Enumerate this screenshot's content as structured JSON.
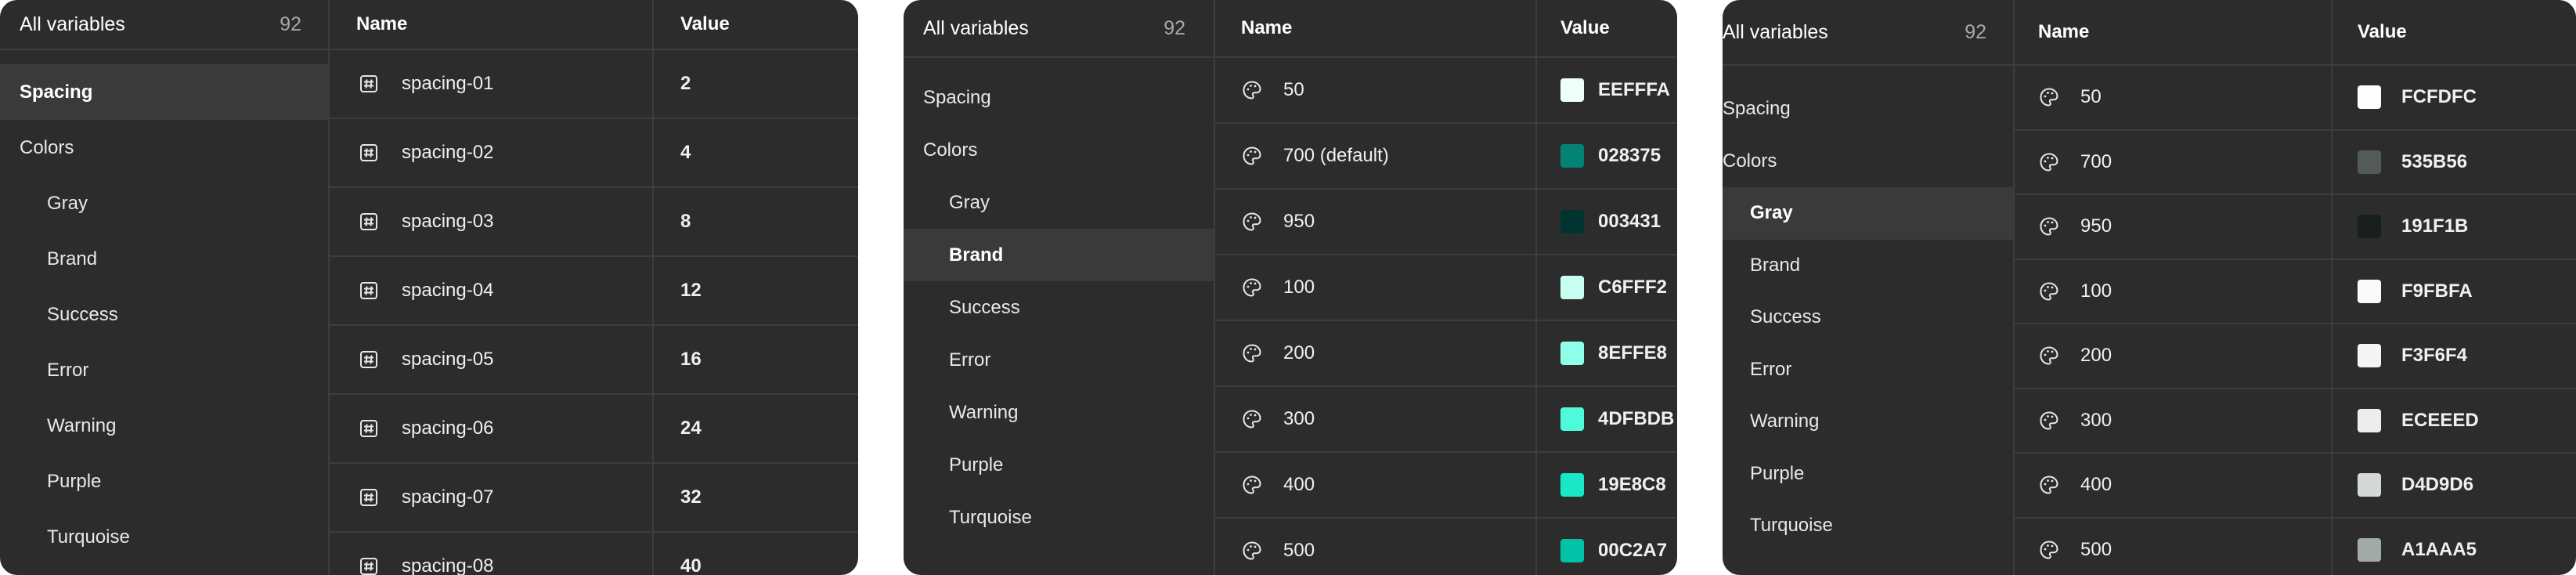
{
  "panels": [
    {
      "header": {
        "title": "All variables",
        "count": "92"
      },
      "sidebar": [
        {
          "label": "Spacing",
          "child": false,
          "selected": true
        },
        {
          "label": "Colors",
          "child": false,
          "selected": false
        },
        {
          "label": "Gray",
          "child": true,
          "selected": false
        },
        {
          "label": "Brand",
          "child": true,
          "selected": false
        },
        {
          "label": "Success",
          "child": true,
          "selected": false
        },
        {
          "label": "Error",
          "child": true,
          "selected": false
        },
        {
          "label": "Warning",
          "child": true,
          "selected": false
        },
        {
          "label": "Purple",
          "child": true,
          "selected": false
        },
        {
          "label": "Turquoise",
          "child": true,
          "selected": false
        }
      ],
      "columns": {
        "name": "Name",
        "value": "Value"
      },
      "row_icon": "number-variable-icon",
      "rows": [
        {
          "name": "spacing-01",
          "value": "2"
        },
        {
          "name": "spacing-02",
          "value": "4"
        },
        {
          "name": "spacing-03",
          "value": "8"
        },
        {
          "name": "spacing-04",
          "value": "12"
        },
        {
          "name": "spacing-05",
          "value": "16"
        },
        {
          "name": "spacing-06",
          "value": "24"
        },
        {
          "name": "spacing-07",
          "value": "32"
        },
        {
          "name": "spacing-08",
          "value": "40"
        }
      ]
    },
    {
      "header": {
        "title": "All variables",
        "count": "92"
      },
      "sidebar": [
        {
          "label": "Spacing",
          "child": false,
          "selected": false
        },
        {
          "label": "Colors",
          "child": false,
          "selected": false
        },
        {
          "label": "Gray",
          "child": true,
          "selected": false
        },
        {
          "label": "Brand",
          "child": true,
          "selected": true
        },
        {
          "label": "Success",
          "child": true,
          "selected": false
        },
        {
          "label": "Error",
          "child": true,
          "selected": false
        },
        {
          "label": "Warning",
          "child": true,
          "selected": false
        },
        {
          "label": "Purple",
          "child": true,
          "selected": false
        },
        {
          "label": "Turquoise",
          "child": true,
          "selected": false
        }
      ],
      "columns": {
        "name": "Name",
        "value": "Value"
      },
      "row_icon": "color-palette-icon",
      "rows": [
        {
          "name": "50",
          "value": "EEFFFA",
          "color": "#EEFFFA"
        },
        {
          "name": "700 (default)",
          "value": "028375",
          "color": "#028375"
        },
        {
          "name": "950",
          "value": "003431",
          "color": "#003431"
        },
        {
          "name": "100",
          "value": "C6FFF2",
          "color": "#C6FFF2"
        },
        {
          "name": "200",
          "value": "8EFFE8",
          "color": "#8EFFE8"
        },
        {
          "name": "300",
          "value": "4DFBDB",
          "color": "#4DFBDB"
        },
        {
          "name": "400",
          "value": "19E8C8",
          "color": "#19E8C8"
        },
        {
          "name": "500",
          "value": "00C2A7",
          "color": "#00C2A7"
        }
      ]
    },
    {
      "header": {
        "title": "All variables",
        "count": "92"
      },
      "sidebar": [
        {
          "label": "Spacing",
          "child": false,
          "selected": false
        },
        {
          "label": "Colors",
          "child": false,
          "selected": false
        },
        {
          "label": "Gray",
          "child": true,
          "selected": true
        },
        {
          "label": "Brand",
          "child": true,
          "selected": false
        },
        {
          "label": "Success",
          "child": true,
          "selected": false
        },
        {
          "label": "Error",
          "child": true,
          "selected": false
        },
        {
          "label": "Warning",
          "child": true,
          "selected": false
        },
        {
          "label": "Purple",
          "child": true,
          "selected": false
        },
        {
          "label": "Turquoise",
          "child": true,
          "selected": false
        }
      ],
      "columns": {
        "name": "Name",
        "value": "Value"
      },
      "row_icon": "color-palette-icon",
      "rows": [
        {
          "name": "50",
          "value": "FCFDFC",
          "color": "#FCFDFC"
        },
        {
          "name": "700",
          "value": "535B56",
          "color": "#535B56"
        },
        {
          "name": "950",
          "value": "191F1B",
          "color": "#191F1B"
        },
        {
          "name": "100",
          "value": "F9FBFA",
          "color": "#F9FBFA"
        },
        {
          "name": "200",
          "value": "F3F6F4",
          "color": "#F3F6F4"
        },
        {
          "name": "300",
          "value": "ECEEED",
          "color": "#ECEEED"
        },
        {
          "name": "400",
          "value": "D4D9D6",
          "color": "#D4D9D6"
        },
        {
          "name": "500",
          "value": "A1AAA5",
          "color": "#A1AAA5"
        }
      ]
    }
  ]
}
